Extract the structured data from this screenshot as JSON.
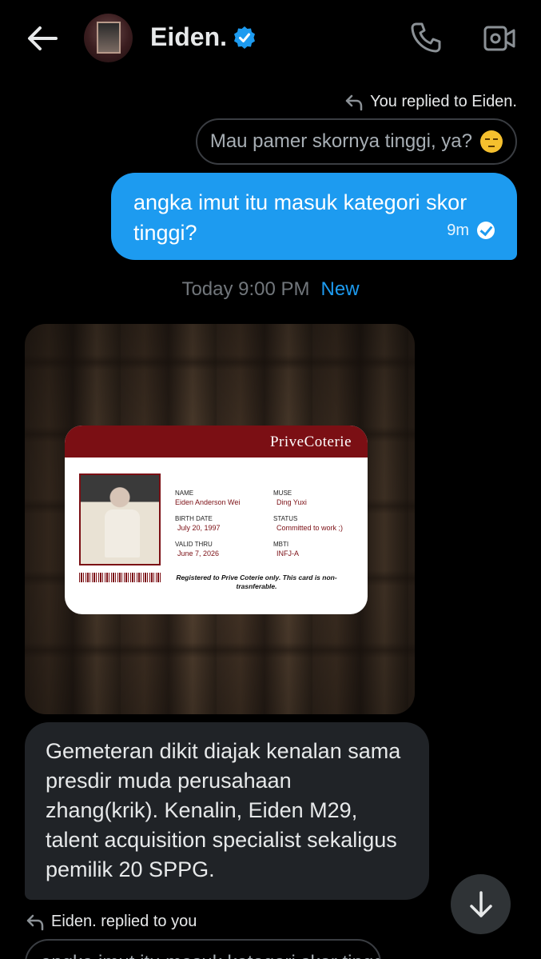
{
  "header": {
    "title": "Eiden.",
    "verified": true,
    "icons": {
      "back": "arrow-left-icon",
      "call": "phone-icon",
      "video": "video-camera-icon",
      "verified": "verified-badge-icon"
    }
  },
  "reply_context_1": {
    "label": "You replied to Eiden.",
    "quoted_text": "Mau pamer skornya tinggi, ya?"
  },
  "sent_message": {
    "text": "angka imut itu masuk kategori skor tinggi?",
    "time": "9m",
    "status": "read"
  },
  "divider": {
    "timestamp": "Today 9:00 PM",
    "new_label": "New"
  },
  "image_card": {
    "brand": "PriveCoterie",
    "fields": {
      "name_label": "NAME",
      "name_value": "Eiden Anderson Wei",
      "muse_label": "MUSE",
      "muse_value": "Ding Yuxi",
      "birth_label": "BIRTH DATE",
      "birth_value": "July 20, 1997",
      "status_label": "STATUS",
      "status_value": "Committed to work ;)",
      "valid_label": "VALID THRU",
      "valid_value": "June 7, 2026",
      "mbti_label": "MBTI",
      "mbti_value": "INFJ-A"
    },
    "note": "Registered to Prive Coterie only. This card is non-trasnferable."
  },
  "received_message": {
    "text": "Gemeteran dikit diajak kenalan sama presdir muda perusahaan zhang(krik). Kenalin, Eiden M29, talent acquisition specialist sekaligus pemilik 20 SPPG."
  },
  "reply_context_2": {
    "label": "Eiden. replied to you",
    "quoted_text": "angka imut itu masuk kategori skor tinggi?"
  },
  "colors": {
    "accent": "#1d9bf0",
    "bubble_received": "#202327",
    "background": "#000000",
    "card_brand": "#7b0f14"
  }
}
